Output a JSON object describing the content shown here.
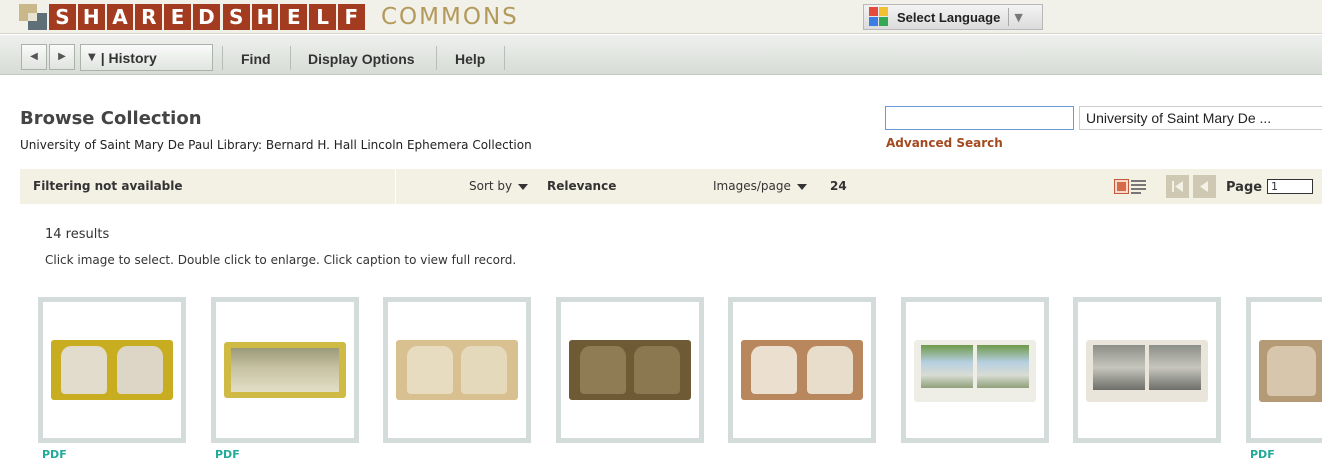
{
  "banner": {
    "logo_letters": [
      "S",
      "H",
      "A",
      "R",
      "E",
      "D",
      "S",
      "H",
      "E",
      "L",
      "F"
    ],
    "logo_suffix": "COMMONS",
    "language_label": "Select Language"
  },
  "toolbar": {
    "history_label": "| History",
    "find_label": "Find",
    "display_options_label": "Display Options",
    "help_label": "Help"
  },
  "header": {
    "title": "Browse Collection",
    "collection": "University of Saint Mary De Paul Library: Bernard H. Hall Lincoln Ephemera Collection"
  },
  "search": {
    "value": "",
    "scope": "University of Saint Mary De ...",
    "advanced_label": "Advanced Search"
  },
  "sortbar": {
    "filter_text": "Filtering not available",
    "sort_label": "Sort by",
    "sort_value": "Relevance",
    "per_page_label": "Images/page",
    "per_page_value": "24",
    "page_label": "Page",
    "page_value": "1"
  },
  "results": {
    "count_text": "14 results",
    "instructions": "Click image to select. Double click to enlarge. Click caption to view full record.",
    "pdf_label": "PDF"
  },
  "colors": {
    "logo_red": "#a23b1f",
    "logo_gold": "#b39a5b",
    "link_orange": "#a24a1f",
    "pdf_teal": "#22aa98",
    "thumb_border": "#d4dcdb",
    "sortbar_bg": "#f3f0e4"
  },
  "icons": [
    "back-arrow-icon",
    "forward-arrow-icon",
    "dropdown-triangle-icon",
    "google-translate-icon",
    "view-toggle-icon",
    "first-page-icon",
    "previous-page-icon"
  ]
}
